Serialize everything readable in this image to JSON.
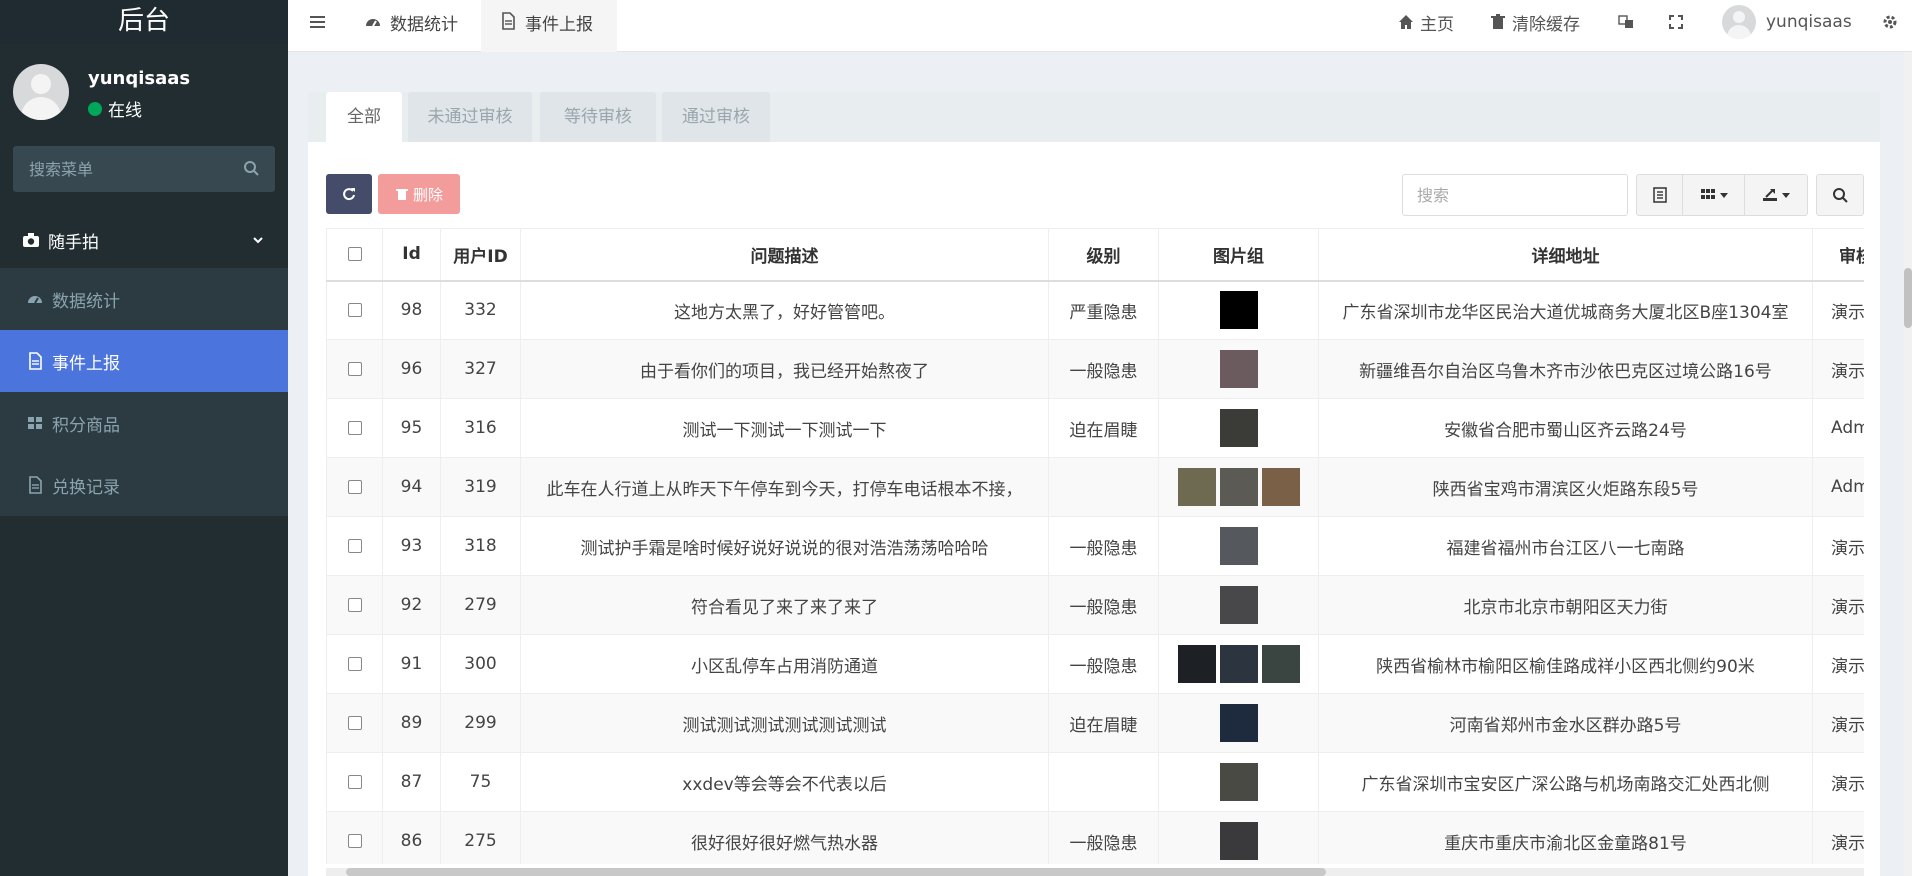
{
  "sidebar": {
    "logo": "后台",
    "user": {
      "name": "yunqisaas",
      "status": "在线"
    },
    "search_placeholder": "搜索菜单",
    "menu_header": "随手拍",
    "items": [
      {
        "label": "数据统计",
        "icon": "dashboard-icon"
      },
      {
        "label": "事件上报",
        "icon": "file-icon",
        "active": true
      },
      {
        "label": "积分商品",
        "icon": "grid-icon"
      },
      {
        "label": "兑换记录",
        "icon": "file-icon"
      }
    ]
  },
  "navbar": {
    "tabs": [
      {
        "label": "数据统计",
        "icon": "dashboard-icon"
      },
      {
        "label": "事件上报",
        "icon": "file-icon",
        "active": true
      }
    ],
    "home": "主页",
    "clear_cache": "清除缓存",
    "username": "yunqisaas"
  },
  "panel": {
    "tabs": [
      "全部",
      "未通过审核",
      "等待审核",
      "通过审核"
    ],
    "delete_label": "删除",
    "search_placeholder": "搜索"
  },
  "table": {
    "columns": [
      "Id",
      "用户ID",
      "问题描述",
      "级别",
      "图片组",
      "详细地址",
      "审核"
    ],
    "rows": [
      {
        "id": "98",
        "uid": "332",
        "desc": "这地方太黑了，好好管管吧。",
        "level": "严重隐患",
        "images": [
          "#000000"
        ],
        "addr": "广东省深圳市龙华区民治大道优城商务大厦北区B座1304室",
        "audit": "演示"
      },
      {
        "id": "96",
        "uid": "327",
        "desc": "由于看你们的项目，我已经开始熬夜了",
        "level": "一般隐患",
        "images": [
          "#6b5a5e"
        ],
        "addr": "新疆维吾尔自治区乌鲁木齐市沙依巴克区过境公路16号",
        "audit": "演示"
      },
      {
        "id": "95",
        "uid": "316",
        "desc": "测试一下测试一下测试一下",
        "level": "迫在眉睫",
        "images": [
          "#3b3b38"
        ],
        "addr": "安徽省合肥市蜀山区齐云路24号",
        "audit": "Adm"
      },
      {
        "id": "94",
        "uid": "319",
        "desc": "此车在人行道上从昨天下午停车到今天，打停车电话根本不接，",
        "level": "",
        "images": [
          "#6e6a52",
          "#5b5a54",
          "#7a6046"
        ],
        "addr": "陕西省宝鸡市渭滨区火炬路东段5号",
        "audit": "Adm"
      },
      {
        "id": "93",
        "uid": "318",
        "desc": "测试护手霜是啥时候好说好说说的很对浩浩荡荡哈哈哈",
        "level": "一般隐患",
        "images": [
          "#55595e"
        ],
        "addr": "福建省福州市台江区八一七南路",
        "audit": "演示"
      },
      {
        "id": "92",
        "uid": "279",
        "desc": "符合看见了来了来了来了",
        "level": "一般隐患",
        "images": [
          "#48484a"
        ],
        "addr": "北京市北京市朝阳区天力街",
        "audit": "演示"
      },
      {
        "id": "91",
        "uid": "300",
        "desc": "小区乱停车占用消防通道",
        "level": "一般隐患",
        "images": [
          "#1d2126",
          "#2c3440",
          "#3a4440"
        ],
        "addr": "陕西省榆林市榆阳区榆佳路成祥小区西北侧约90米",
        "audit": "演示"
      },
      {
        "id": "89",
        "uid": "299",
        "desc": "测试测试测试测试测试测试",
        "level": "迫在眉睫",
        "images": [
          "#1e2a3e"
        ],
        "addr": "河南省郑州市金水区群办路5号",
        "audit": "演示"
      },
      {
        "id": "87",
        "uid": "75",
        "desc": "xxdev等会等会不代表以后",
        "level": "",
        "images": [
          "#4a4a44"
        ],
        "addr": "广东省深圳市宝安区广深公路与机场南路交汇处西北侧",
        "audit": "演示"
      },
      {
        "id": "86",
        "uid": "275",
        "desc": "很好很好很好燃气热水器",
        "level": "一般隐患",
        "images": [
          "#3a3a3c"
        ],
        "addr": "重庆市重庆市渝北区金童路81号",
        "audit": "演示"
      }
    ]
  }
}
